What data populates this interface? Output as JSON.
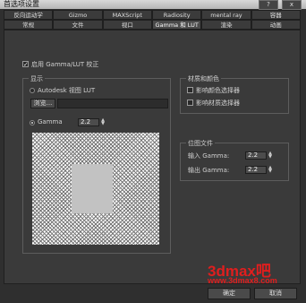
{
  "window": {
    "title": "首选项设置",
    "help_button": "?",
    "close_button": "x"
  },
  "tabs_row1": [
    "反向运动学",
    "Gizmo",
    "MAXScript",
    "Radiosity",
    "mental ray",
    "容器"
  ],
  "tabs_row2": [
    "常规",
    "文件",
    "视口",
    "Gamma 和 LUT",
    "渲染",
    "动画"
  ],
  "active_tab": "Gamma 和 LUT",
  "enable_gamma": {
    "label": "启用 Gamma/LUT 校正",
    "checked": true
  },
  "display": {
    "legend": "显示",
    "autodesk_lut_label": "Autodesk 视图 LUT",
    "browse_button": "浏览...",
    "lut_path": "",
    "gamma_label": "Gamma",
    "gamma_value": "2.2"
  },
  "materials_colors": {
    "legend": "材质和颜色",
    "affect_color_selectors": {
      "label": "影响颜色选择器",
      "checked": false
    },
    "affect_material_selectors": {
      "label": "影响材质选择器",
      "checked": false
    }
  },
  "bitmap_files": {
    "legend": "位图文件",
    "input_gamma_label": "输入 Gamma:",
    "input_gamma_value": "2.2",
    "output_gamma_label": "输出 Gamma:",
    "output_gamma_value": "2.2"
  },
  "footer": {
    "ok_button": "确定",
    "cancel_button": "取消"
  },
  "watermark": {
    "brand": "3dmax吧",
    "url": "www.3dmax8.com"
  },
  "colors": {
    "accent_watermark": "#e01e1e",
    "panel": "#3a3a3a",
    "background": "#2f2f2f"
  }
}
